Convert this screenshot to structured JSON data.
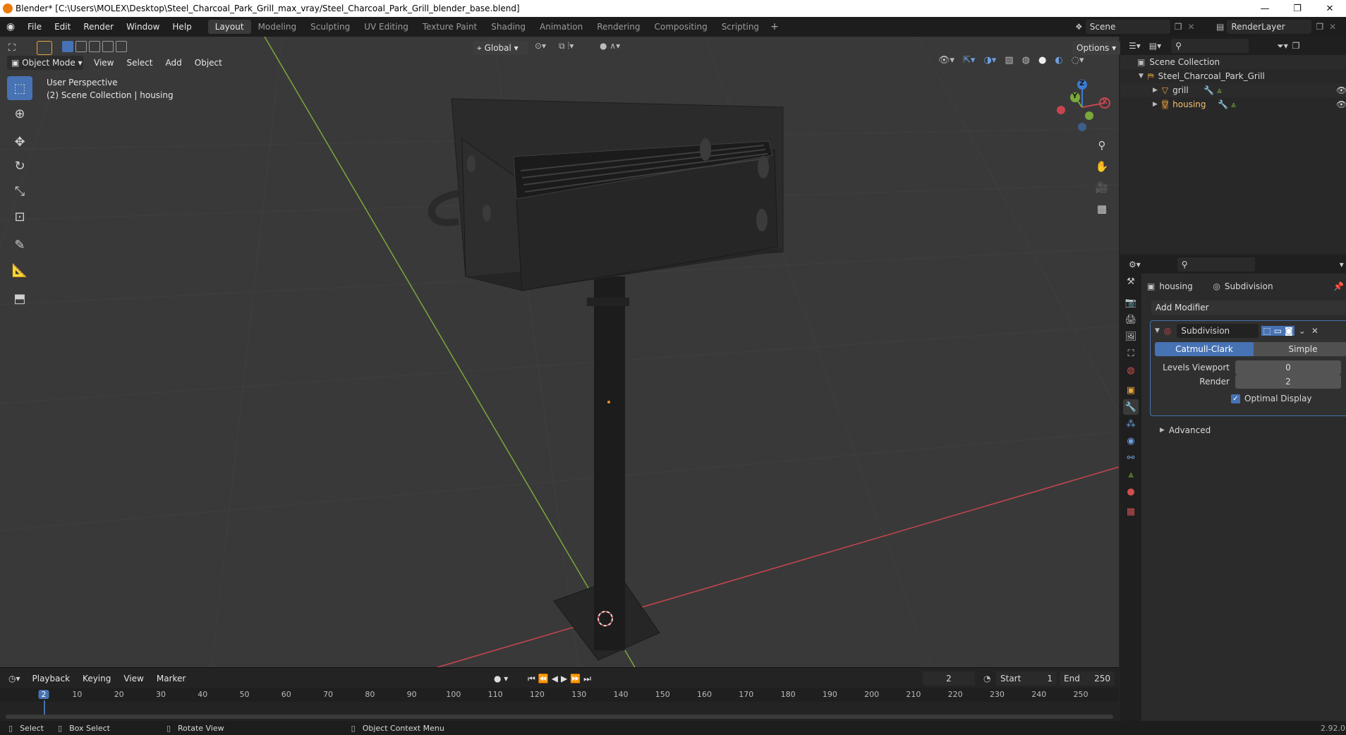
{
  "window": {
    "title": "Blender* [C:\\Users\\MOLEX\\Desktop\\Steel_Charcoal_Park_Grill_max_vray/Steel_Charcoal_Park_Grill_blender_base.blend]",
    "minimize": "—",
    "maximize": "❐",
    "close": "✕"
  },
  "menus": [
    "File",
    "Edit",
    "Render",
    "Window",
    "Help"
  ],
  "workspaces": [
    "Layout",
    "Modeling",
    "Sculpting",
    "UV Editing",
    "Texture Paint",
    "Shading",
    "Animation",
    "Rendering",
    "Compositing",
    "Scripting"
  ],
  "active_workspace": "Layout",
  "scene": {
    "name": "Scene",
    "view_layer": "RenderLayer"
  },
  "tool_header": {
    "orientation": "Global",
    "options": "Options"
  },
  "viewport_header": {
    "mode": "Object Mode",
    "menus": [
      "View",
      "Select",
      "Add",
      "Object"
    ]
  },
  "viewport_overlay": {
    "line1": "User Perspective",
    "line2": "(2) Scene Collection | housing"
  },
  "gizmo": {
    "x": "X",
    "y": "Y",
    "z": "Z"
  },
  "outliner": {
    "root": "Scene Collection",
    "collection": "Steel_Charcoal_Park_Grill",
    "objects": [
      "grill",
      "housing"
    ]
  },
  "properties": {
    "object_name": "housing",
    "modifier_breadcrumb": "Subdivision",
    "add_modifier": "Add Modifier",
    "modifier": {
      "name": "Subdivision",
      "type_options": [
        "Catmull-Clark",
        "Simple"
      ],
      "active_type": "Catmull-Clark",
      "levels_viewport_label": "Levels Viewport",
      "levels_viewport": "0",
      "render_label": "Render",
      "render": "2",
      "optimal_display_label": "Optimal Display",
      "optimal_display": true,
      "advanced_label": "Advanced"
    }
  },
  "timeline": {
    "menus": [
      "Playback",
      "Keying",
      "View",
      "Marker"
    ],
    "current_frame": "2",
    "start_label": "Start",
    "start": "1",
    "end_label": "End",
    "end": "250",
    "ruler": [
      "2",
      "10",
      "20",
      "30",
      "40",
      "50",
      "60",
      "70",
      "80",
      "90",
      "100",
      "110",
      "120",
      "130",
      "140",
      "150",
      "160",
      "170",
      "180",
      "190",
      "200",
      "210",
      "220",
      "230",
      "240",
      "250"
    ]
  },
  "statusbar": {
    "select": "Select",
    "box_select": "Box Select",
    "rotate_view": "Rotate View",
    "context_menu": "Object Context Menu",
    "version": "2.92.0"
  },
  "colors": {
    "accent": "#4772b3",
    "x_axis": "#c8454f",
    "y_axis": "#7aa83b",
    "z_axis": "#3d7cd3",
    "selection": "#f08e2b"
  }
}
